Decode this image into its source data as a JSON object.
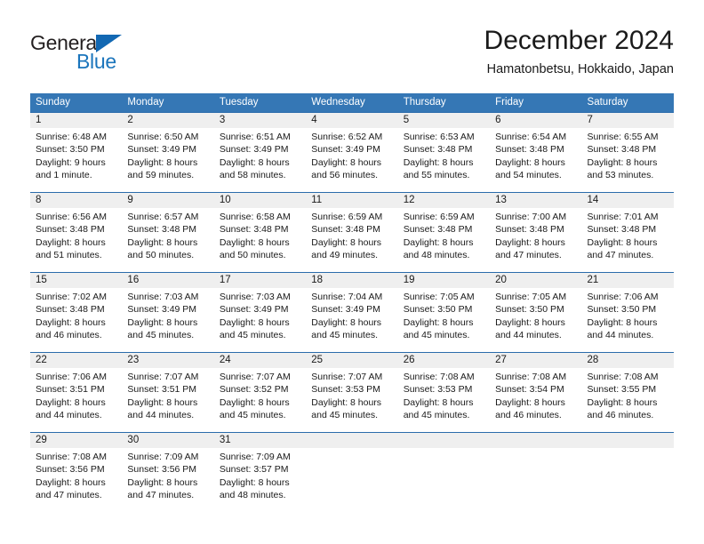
{
  "brand": {
    "name_part1": "General",
    "name_part2": "Blue",
    "triangle_icon": "triangle-icon",
    "primary_color": "#1b75bc"
  },
  "header": {
    "title": "December 2024",
    "subtitle": "Hamatonbetsu, Hokkaido, Japan"
  },
  "calendar": {
    "header_bg": "#3577b5",
    "daynum_bg": "#efefef",
    "rule_color": "#2b6cab",
    "weekdays": [
      "Sunday",
      "Monday",
      "Tuesday",
      "Wednesday",
      "Thursday",
      "Friday",
      "Saturday"
    ],
    "weeks": [
      [
        {
          "day": "1",
          "sunrise": "Sunrise: 6:48 AM",
          "sunset": "Sunset: 3:50 PM",
          "daylight1": "Daylight: 9 hours",
          "daylight2": "and 1 minute."
        },
        {
          "day": "2",
          "sunrise": "Sunrise: 6:50 AM",
          "sunset": "Sunset: 3:49 PM",
          "daylight1": "Daylight: 8 hours",
          "daylight2": "and 59 minutes."
        },
        {
          "day": "3",
          "sunrise": "Sunrise: 6:51 AM",
          "sunset": "Sunset: 3:49 PM",
          "daylight1": "Daylight: 8 hours",
          "daylight2": "and 58 minutes."
        },
        {
          "day": "4",
          "sunrise": "Sunrise: 6:52 AM",
          "sunset": "Sunset: 3:49 PM",
          "daylight1": "Daylight: 8 hours",
          "daylight2": "and 56 minutes."
        },
        {
          "day": "5",
          "sunrise": "Sunrise: 6:53 AM",
          "sunset": "Sunset: 3:48 PM",
          "daylight1": "Daylight: 8 hours",
          "daylight2": "and 55 minutes."
        },
        {
          "day": "6",
          "sunrise": "Sunrise: 6:54 AM",
          "sunset": "Sunset: 3:48 PM",
          "daylight1": "Daylight: 8 hours",
          "daylight2": "and 54 minutes."
        },
        {
          "day": "7",
          "sunrise": "Sunrise: 6:55 AM",
          "sunset": "Sunset: 3:48 PM",
          "daylight1": "Daylight: 8 hours",
          "daylight2": "and 53 minutes."
        }
      ],
      [
        {
          "day": "8",
          "sunrise": "Sunrise: 6:56 AM",
          "sunset": "Sunset: 3:48 PM",
          "daylight1": "Daylight: 8 hours",
          "daylight2": "and 51 minutes."
        },
        {
          "day": "9",
          "sunrise": "Sunrise: 6:57 AM",
          "sunset": "Sunset: 3:48 PM",
          "daylight1": "Daylight: 8 hours",
          "daylight2": "and 50 minutes."
        },
        {
          "day": "10",
          "sunrise": "Sunrise: 6:58 AM",
          "sunset": "Sunset: 3:48 PM",
          "daylight1": "Daylight: 8 hours",
          "daylight2": "and 50 minutes."
        },
        {
          "day": "11",
          "sunrise": "Sunrise: 6:59 AM",
          "sunset": "Sunset: 3:48 PM",
          "daylight1": "Daylight: 8 hours",
          "daylight2": "and 49 minutes."
        },
        {
          "day": "12",
          "sunrise": "Sunrise: 6:59 AM",
          "sunset": "Sunset: 3:48 PM",
          "daylight1": "Daylight: 8 hours",
          "daylight2": "and 48 minutes."
        },
        {
          "day": "13",
          "sunrise": "Sunrise: 7:00 AM",
          "sunset": "Sunset: 3:48 PM",
          "daylight1": "Daylight: 8 hours",
          "daylight2": "and 47 minutes."
        },
        {
          "day": "14",
          "sunrise": "Sunrise: 7:01 AM",
          "sunset": "Sunset: 3:48 PM",
          "daylight1": "Daylight: 8 hours",
          "daylight2": "and 47 minutes."
        }
      ],
      [
        {
          "day": "15",
          "sunrise": "Sunrise: 7:02 AM",
          "sunset": "Sunset: 3:48 PM",
          "daylight1": "Daylight: 8 hours",
          "daylight2": "and 46 minutes."
        },
        {
          "day": "16",
          "sunrise": "Sunrise: 7:03 AM",
          "sunset": "Sunset: 3:49 PM",
          "daylight1": "Daylight: 8 hours",
          "daylight2": "and 45 minutes."
        },
        {
          "day": "17",
          "sunrise": "Sunrise: 7:03 AM",
          "sunset": "Sunset: 3:49 PM",
          "daylight1": "Daylight: 8 hours",
          "daylight2": "and 45 minutes."
        },
        {
          "day": "18",
          "sunrise": "Sunrise: 7:04 AM",
          "sunset": "Sunset: 3:49 PM",
          "daylight1": "Daylight: 8 hours",
          "daylight2": "and 45 minutes."
        },
        {
          "day": "19",
          "sunrise": "Sunrise: 7:05 AM",
          "sunset": "Sunset: 3:50 PM",
          "daylight1": "Daylight: 8 hours",
          "daylight2": "and 45 minutes."
        },
        {
          "day": "20",
          "sunrise": "Sunrise: 7:05 AM",
          "sunset": "Sunset: 3:50 PM",
          "daylight1": "Daylight: 8 hours",
          "daylight2": "and 44 minutes."
        },
        {
          "day": "21",
          "sunrise": "Sunrise: 7:06 AM",
          "sunset": "Sunset: 3:50 PM",
          "daylight1": "Daylight: 8 hours",
          "daylight2": "and 44 minutes."
        }
      ],
      [
        {
          "day": "22",
          "sunrise": "Sunrise: 7:06 AM",
          "sunset": "Sunset: 3:51 PM",
          "daylight1": "Daylight: 8 hours",
          "daylight2": "and 44 minutes."
        },
        {
          "day": "23",
          "sunrise": "Sunrise: 7:07 AM",
          "sunset": "Sunset: 3:51 PM",
          "daylight1": "Daylight: 8 hours",
          "daylight2": "and 44 minutes."
        },
        {
          "day": "24",
          "sunrise": "Sunrise: 7:07 AM",
          "sunset": "Sunset: 3:52 PM",
          "daylight1": "Daylight: 8 hours",
          "daylight2": "and 45 minutes."
        },
        {
          "day": "25",
          "sunrise": "Sunrise: 7:07 AM",
          "sunset": "Sunset: 3:53 PM",
          "daylight1": "Daylight: 8 hours",
          "daylight2": "and 45 minutes."
        },
        {
          "day": "26",
          "sunrise": "Sunrise: 7:08 AM",
          "sunset": "Sunset: 3:53 PM",
          "daylight1": "Daylight: 8 hours",
          "daylight2": "and 45 minutes."
        },
        {
          "day": "27",
          "sunrise": "Sunrise: 7:08 AM",
          "sunset": "Sunset: 3:54 PM",
          "daylight1": "Daylight: 8 hours",
          "daylight2": "and 46 minutes."
        },
        {
          "day": "28",
          "sunrise": "Sunrise: 7:08 AM",
          "sunset": "Sunset: 3:55 PM",
          "daylight1": "Daylight: 8 hours",
          "daylight2": "and 46 minutes."
        }
      ],
      [
        {
          "day": "29",
          "sunrise": "Sunrise: 7:08 AM",
          "sunset": "Sunset: 3:56 PM",
          "daylight1": "Daylight: 8 hours",
          "daylight2": "and 47 minutes."
        },
        {
          "day": "30",
          "sunrise": "Sunrise: 7:09 AM",
          "sunset": "Sunset: 3:56 PM",
          "daylight1": "Daylight: 8 hours",
          "daylight2": "and 47 minutes."
        },
        {
          "day": "31",
          "sunrise": "Sunrise: 7:09 AM",
          "sunset": "Sunset: 3:57 PM",
          "daylight1": "Daylight: 8 hours",
          "daylight2": "and 48 minutes."
        },
        {
          "day": "",
          "sunrise": "",
          "sunset": "",
          "daylight1": "",
          "daylight2": ""
        },
        {
          "day": "",
          "sunrise": "",
          "sunset": "",
          "daylight1": "",
          "daylight2": ""
        },
        {
          "day": "",
          "sunrise": "",
          "sunset": "",
          "daylight1": "",
          "daylight2": ""
        },
        {
          "day": "",
          "sunrise": "",
          "sunset": "",
          "daylight1": "",
          "daylight2": ""
        }
      ]
    ]
  }
}
